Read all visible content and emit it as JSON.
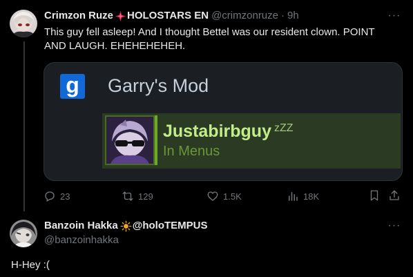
{
  "tweet1": {
    "display_name": "Crimzon Ruze",
    "name_suffix": "HOLOSTARS EN",
    "handle": "@crimzonruze",
    "separator": "·",
    "time": "9h",
    "text": "This guy fell asleep!  And I thought Bettel was our resident clown.  POINT AND LAUGH.  EHEHEHEHEH.",
    "more": "···",
    "media": {
      "app_icon_letter": "g",
      "game_title": "Garry's Mod",
      "friend_name": "Justabirbguy",
      "sleep_indicator": "zZZ",
      "friend_status": "In Menus",
      "colors": {
        "card_bg": "#1b1e23",
        "friend_row_bg": "#2a3a23",
        "friend_name": "#c3ec8a",
        "friend_status": "#6b9636",
        "app_icon": "#1169d8"
      }
    },
    "actions": {
      "replies": "23",
      "retweets": "129",
      "likes": "1.5K",
      "views": "18K"
    }
  },
  "tweet2": {
    "display_name": "Banzoin Hakka",
    "handle_inline": "@holoTEMPUS",
    "handle": "@banzoinhakka",
    "more": "···",
    "text": "H-Hey :("
  },
  "icons": {
    "name_badge_1": "spark-icon",
    "name_badge_2": "sun-icon",
    "reply": "reply-icon",
    "retweet": "retweet-icon",
    "like": "heart-icon",
    "views": "views-icon",
    "bookmark": "bookmark-icon",
    "share": "share-icon"
  }
}
